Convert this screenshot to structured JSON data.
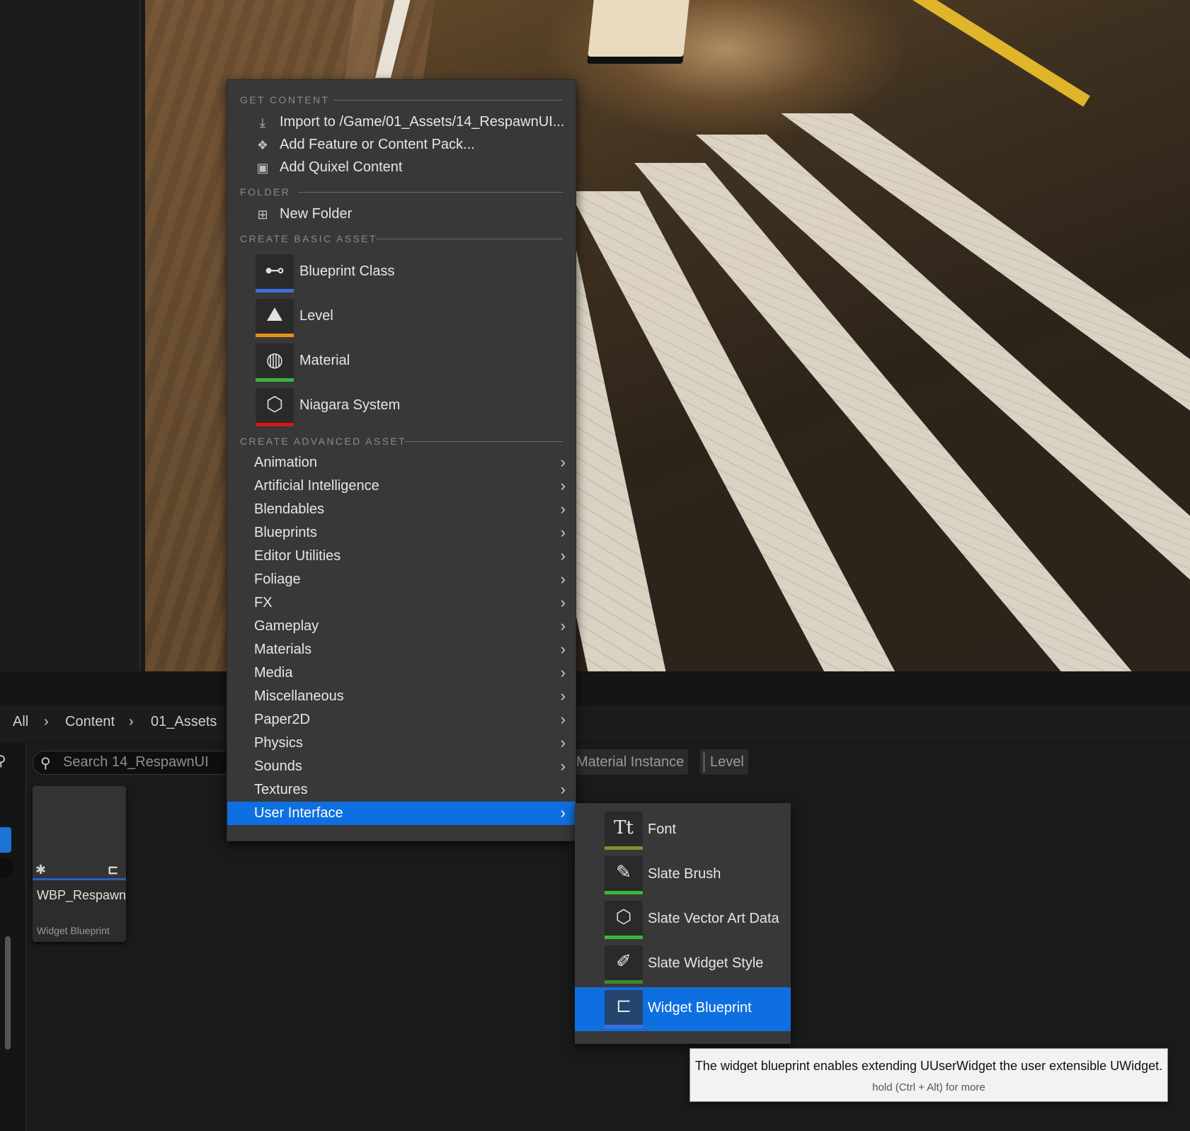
{
  "breadcrumb": {
    "items": [
      "All",
      "Content",
      "01_Assets"
    ],
    "separator": "›"
  },
  "search": {
    "placeholder": "Search 14_RespawnUI"
  },
  "filters": [
    "Material Instance",
    "Level"
  ],
  "asset": {
    "name": "WBP_Respawn",
    "type": "Widget Blueprint"
  },
  "menu": {
    "get_content": {
      "header": "GET CONTENT",
      "items": [
        {
          "label": "Import to /Game/01_Assets/14_RespawnUI...",
          "icon": "import-icon"
        },
        {
          "label": "Add Feature or Content Pack...",
          "icon": "feature-pack-icon"
        },
        {
          "label": "Add Quixel Content",
          "icon": "quixel-icon"
        }
      ]
    },
    "folder": {
      "header": "FOLDER",
      "items": [
        {
          "label": "New Folder",
          "icon": "new-folder-icon"
        }
      ]
    },
    "basic": {
      "header": "CREATE BASIC ASSET",
      "items": [
        {
          "label": "Blueprint Class",
          "icon": "blueprint-class-icon",
          "color": "#3d6fe0"
        },
        {
          "label": "Level",
          "icon": "level-icon",
          "color": "#e8901a"
        },
        {
          "label": "Material",
          "icon": "material-icon",
          "color": "#3db43d"
        },
        {
          "label": "Niagara System",
          "icon": "niagara-icon",
          "color": "#d01818"
        }
      ]
    },
    "advanced": {
      "header": "CREATE ADVANCED ASSET",
      "items": [
        "Animation",
        "Artificial Intelligence",
        "Blendables",
        "Blueprints",
        "Editor Utilities",
        "Foliage",
        "FX",
        "Gameplay",
        "Materials",
        "Media",
        "Miscellaneous",
        "Paper2D",
        "Physics",
        "Sounds",
        "Textures",
        "User Interface"
      ],
      "active": "User Interface"
    }
  },
  "submenu": {
    "items": [
      {
        "label": "Font",
        "icon": "font-icon",
        "color": "#8a8a30"
      },
      {
        "label": "Slate Brush",
        "icon": "slate-brush-icon",
        "color": "#3db43d"
      },
      {
        "label": "Slate Vector Art Data",
        "icon": "vector-art-icon",
        "color": "#3db43d"
      },
      {
        "label": "Slate Widget Style",
        "icon": "widget-style-icon",
        "color": "#3a8a30"
      },
      {
        "label": "Widget Blueprint",
        "icon": "widget-blueprint-icon",
        "color": "#3d6fe0"
      }
    ],
    "active": "Widget Blueprint"
  },
  "tooltip": {
    "text": "The widget blueprint enables extending UUserWidget the user extensible UWidget.",
    "hint": "hold (Ctrl + Alt) for more"
  }
}
